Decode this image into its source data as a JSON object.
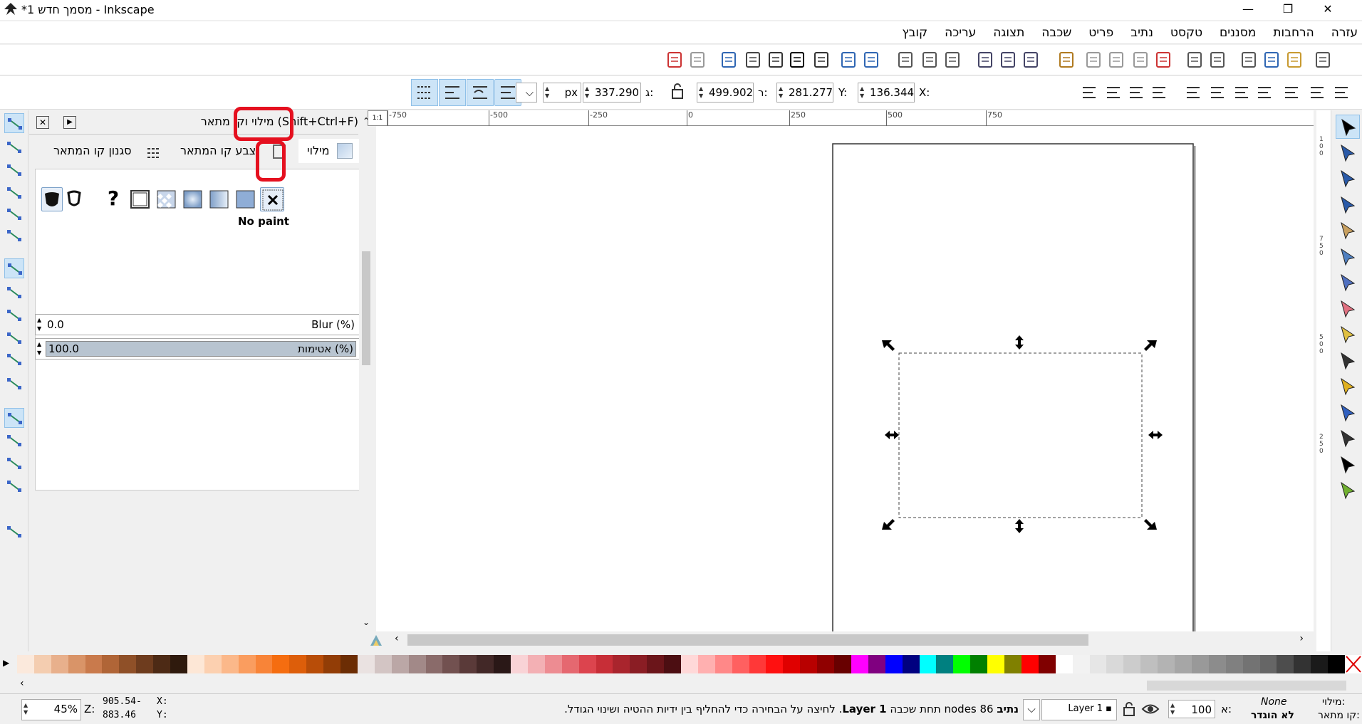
{
  "window": {
    "title": "*מסמך חדש 1 - Inkscape",
    "minimize": "—",
    "restore": "❐",
    "close": "✕"
  },
  "menu": [
    "קובץ",
    "עריכה",
    "תצוגה",
    "שכבה",
    "פריט",
    "נתיב",
    "טקסט",
    "מסננים",
    "הרחבות",
    "עזרה"
  ],
  "controls": {
    "x_label": "X:",
    "x_value": "136.344",
    "y_label": "Y:",
    "y_value": "281.277",
    "w_label": "ר:",
    "w_value": "499.902",
    "h_label": "ג:",
    "h_value": "337.290",
    "unit": "px"
  },
  "dock": {
    "title": "מילוי וקו מתאר (Shift+Ctrl+F)",
    "tab_fill": "מילוי",
    "tab_stroke_paint": "צבע קו המתאר",
    "tab_stroke_style": "סגנון קו המתאר",
    "paint_mode_label": "No paint",
    "unknown_glyph": "?",
    "blur_label": "Blur (%)",
    "blur_value": "0.0",
    "opacity_label": "אטימות (%)",
    "opacity_value": "100.0"
  },
  "ruler": {
    "h_ticks": [
      "-750",
      "-500",
      "-250",
      "0",
      "250",
      "500",
      "750"
    ],
    "v_ticks": [
      "100",
      "750",
      "500",
      "250"
    ]
  },
  "status": {
    "fill_label": "מילוי:",
    "fill_value": "None",
    "stroke_label": "קו מתאר:",
    "stroke_value": "לא הוגדר",
    "opacity_label": "א:",
    "opacity_value": "100",
    "layer": "Layer 1",
    "message_bold": "נתיב",
    "message_count": "86 nodes",
    "message_mid": "תחת שכבה",
    "message_layer": "Layer 1",
    "message_rest": ". לחיצה על הבחירה כדי להחליף בין ידיות ההטיה ושינוי הגודל.",
    "x_label": "X:",
    "x_value": "905.54-",
    "y_label": "Y:",
    "y_value": "883.46",
    "zoom_label": "Z:",
    "zoom_value": "45%"
  },
  "colors": {
    "accent": "#e5101f",
    "selection_bg": "#cce4f7"
  },
  "palette": [
    "#fbe9dc",
    "#f4cdb0",
    "#e8b08c",
    "#d99468",
    "#c97a4c",
    "#b06537",
    "#8f5028",
    "#6e3c1e",
    "#4d2a15",
    "#2f1a0d",
    "#fde7d6",
    "#fcd0b0",
    "#fbb88a",
    "#fa9d5f",
    "#f88438",
    "#f56d10",
    "#dd5e0a",
    "#b84d08",
    "#923d06",
    "#6c2d04",
    "#eae2e1",
    "#d3c5c4",
    "#bba7a6",
    "#a28988",
    "#8a6b6a",
    "#725150",
    "#5a3a39",
    "#422827",
    "#2a1817",
    "#f9d3d6",
    "#f3b0b4",
    "#ed8c92",
    "#e56870",
    "#dc444e",
    "#c72e37",
    "#a9252d",
    "#8a1d24",
    "#6b151a",
    "#4c0e12",
    "#ffd8d8",
    "#ffb0b0",
    "#ff8888",
    "#ff6060",
    "#ff3838",
    "#ff1010",
    "#e00000",
    "#b80000",
    "#900000",
    "#680000",
    "#ff00ff",
    "#800080",
    "#0000ff",
    "#000080",
    "#00ffff",
    "#008080",
    "#00ff00",
    "#008000",
    "#ffff00",
    "#808000",
    "#ff0000",
    "#800000",
    "#ffffff",
    "#f2f2f2",
    "#e6e6e6",
    "#d9d9d9",
    "#cccccc",
    "#bfbfbf",
    "#b3b3b3",
    "#a6a6a6",
    "#999999",
    "#8c8c8c",
    "#808080",
    "#737373",
    "#666666",
    "#4d4d4d",
    "#333333",
    "#1a1a1a",
    "#000000"
  ]
}
